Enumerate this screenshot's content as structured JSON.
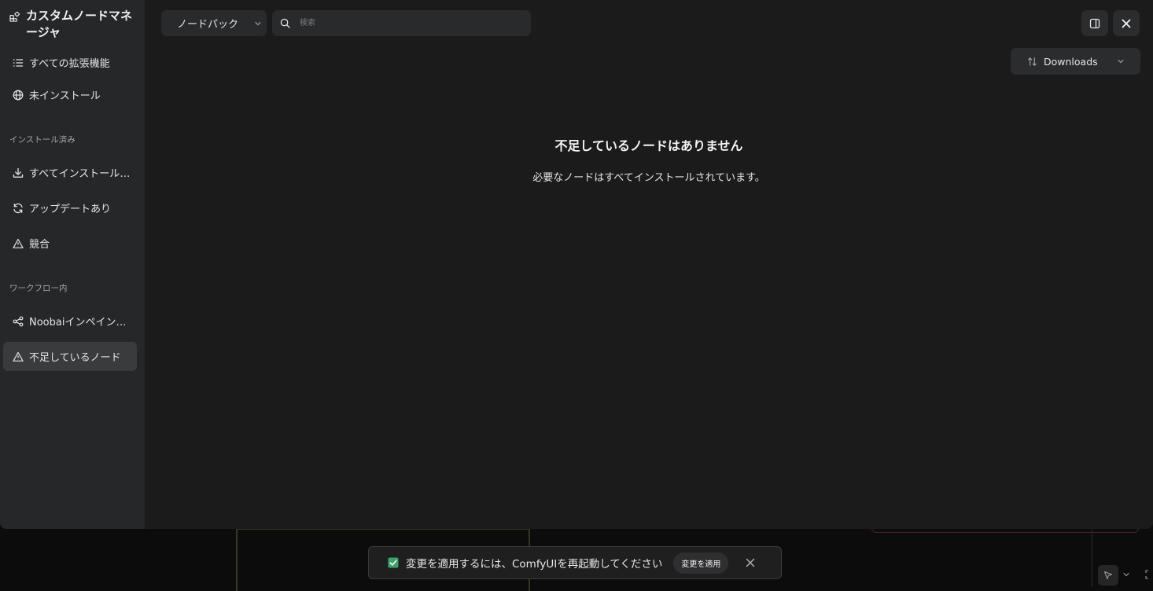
{
  "sidebar": {
    "title": "カスタムノードマネージャ",
    "items_top": [
      {
        "label": "すべての拡張機能",
        "icon": "list-icon"
      },
      {
        "label": "未インストール",
        "icon": "globe-icon"
      }
    ],
    "section_installed": "インストール済み",
    "items_installed": [
      {
        "label": "すべてインストール済み",
        "icon": "download-icon"
      },
      {
        "label": "アップデートあり",
        "icon": "refresh-icon"
      },
      {
        "label": "競合",
        "icon": "warning-icon"
      }
    ],
    "section_workflow": "ワークフロー内",
    "items_workflow": [
      {
        "label": "Noobaiインペインティング",
        "icon": "share-nodes-icon"
      },
      {
        "label": "不足しているノード",
        "icon": "warning-icon",
        "active": true
      }
    ]
  },
  "header": {
    "filter_label": "ノードパック",
    "search_placeholder": "検索",
    "sort_label": "Downloads"
  },
  "empty_state": {
    "title": "不足しているノードはありません",
    "description": "必要なノードはすべてインストールされています。"
  },
  "toast": {
    "message": "変更を適用するには、ComfyUIを再起動してください",
    "apply_label": "変更を適用"
  },
  "colors": {
    "dialog_bg": "#1b1b1b",
    "sidebar_bg": "#262729",
    "active_item_bg": "#3a3b3d",
    "check_green": "#3aa56a"
  }
}
